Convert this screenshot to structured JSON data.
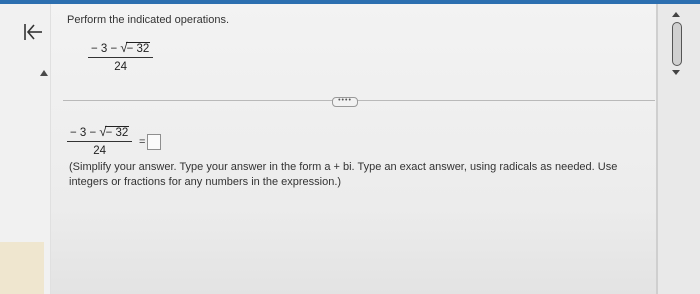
{
  "problem": {
    "instruction": "Perform the indicated operations.",
    "expression": {
      "numerator_prefix": "− 3 −",
      "radical_sign": "√",
      "radicand": "− 32",
      "denominator": "24"
    }
  },
  "answer": {
    "equals_sign": "=",
    "hint_line1": "(Simplify your answer. Type your answer in the form a + bi. Type an exact answer, using radicals as needed. Use",
    "hint_line2": "integers or fractions for any numbers in the expression.)"
  },
  "more_button": {
    "label": "••••"
  },
  "icons": {
    "back": "back-to-start-icon",
    "collapse": "collapse-arrow-icon",
    "scroll_up": "scroll-up-arrow-icon",
    "scroll_down": "scroll-down-arrow-icon"
  },
  "colors": {
    "accent_bar": "#2c6fb0",
    "background": "#ececec"
  }
}
